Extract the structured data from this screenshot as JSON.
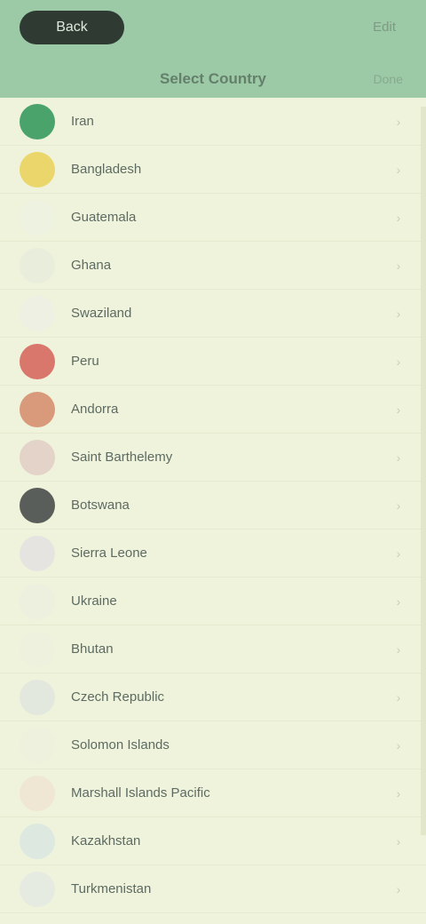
{
  "header": {
    "back_label": "Back",
    "action_label": "Edit",
    "title": "Select Country",
    "right_label": "Done"
  },
  "items": [
    {
      "label": "Iran",
      "icon_color": "#4aa36a"
    },
    {
      "label": "Bangladesh",
      "icon_color": "#ead66a"
    },
    {
      "label": "Guatemala",
      "icon_color": "#eef2e0"
    },
    {
      "label": "Ghana",
      "icon_color": "#e8eedb"
    },
    {
      "label": "Swaziland",
      "icon_color": "#eef0e3"
    },
    {
      "label": "Peru",
      "icon_color": "#d9776c"
    },
    {
      "label": "Andorra",
      "icon_color": "#d89a7a"
    },
    {
      "label": "Saint Barthelemy",
      "icon_color": "#e3d3c8"
    },
    {
      "label": "Botswana",
      "icon_color": "#5a5e5a"
    },
    {
      "label": "Sierra Leone",
      "icon_color": "#e6e4e1"
    },
    {
      "label": "Ukraine",
      "icon_color": "#eef0df"
    },
    {
      "label": "Bhutan",
      "icon_color": "#eef1de"
    },
    {
      "label": "Czech Republic",
      "icon_color": "#e2e8dd"
    },
    {
      "label": "Solomon Islands",
      "icon_color": "#eef1de"
    },
    {
      "label": "Marshall Islands Pacific",
      "icon_color": "#efe7d3"
    },
    {
      "label": "Kazakhstan",
      "icon_color": "#dde8e1"
    },
    {
      "label": "Turkmenistan",
      "icon_color": "#e6ebe2"
    }
  ]
}
